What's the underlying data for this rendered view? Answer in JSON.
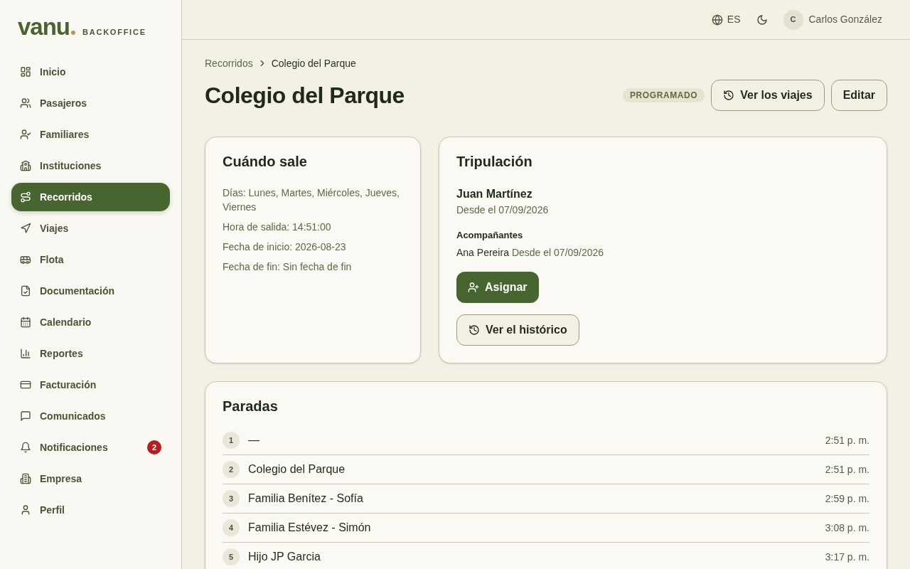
{
  "sidebar": {
    "logo": {
      "wordmark": "vanu",
      "subtitle": "BACKOFFICE"
    },
    "items": [
      {
        "label": "Inicio",
        "selected": false
      },
      {
        "label": "Pasajeros",
        "selected": false
      },
      {
        "label": "Familiares",
        "selected": false
      },
      {
        "label": "Instituciones",
        "selected": false
      },
      {
        "label": "Recorridos",
        "selected": true
      },
      {
        "label": "Viajes",
        "selected": false
      },
      {
        "label": "Flota",
        "selected": false
      },
      {
        "label": "Documentación",
        "selected": false
      },
      {
        "label": "Calendario",
        "selected": false
      },
      {
        "label": "Reportes",
        "selected": false
      },
      {
        "label": "Facturación",
        "selected": false
      },
      {
        "label": "Comunicados",
        "selected": false
      },
      {
        "label": "Notificaciones",
        "selected": false,
        "badge": "2"
      },
      {
        "label": "Empresa",
        "selected": false
      },
      {
        "label": "Perfil",
        "selected": false
      }
    ]
  },
  "topbar": {
    "language": "ES",
    "user": {
      "initial": "C",
      "name": "Carlos González"
    }
  },
  "breadcrumb": [
    "Recorridos",
    "Colegio del Parque"
  ],
  "header": {
    "title": "Colegio del Parque",
    "status": "PROGRAMADO",
    "buttons": [
      "Ver los viajes",
      "Editar"
    ]
  },
  "schedule": {
    "title": "Cuándo sale",
    "lines": [
      "Días: Lunes, Martes, Miércoles, Jueves, Viernes",
      "Hora de salida: 14:51:00",
      "Fecha de inicio: 2026-08-23",
      "Fecha de fin: Sin fecha de fin"
    ]
  },
  "crew": {
    "title": "Tripulación",
    "driver": {
      "name": "Juan Martínez",
      "since": "Desde el 07/09/2026"
    },
    "companions_label": "Acompañantes",
    "companions": [
      {
        "name": "Ana Pereira",
        "since": "Desde el 07/09/2026"
      }
    ],
    "assign_button": "Asignar",
    "history_button": "Ver el histórico"
  },
  "stops": {
    "title": "Paradas",
    "rows": [
      {
        "number": "1",
        "name": "—",
        "time": "2:51 p. m."
      },
      {
        "number": "2",
        "name": "Colegio del Parque",
        "time": "2:51 p. m."
      },
      {
        "number": "3",
        "name": "Familia Benítez - Sofía",
        "time": "2:59 p. m."
      },
      {
        "number": "4",
        "name": "Familia Estévez - Simón",
        "time": "3:08 p. m."
      },
      {
        "number": "5",
        "name": "Hijo JP Garcia",
        "time": "3:17 p. m."
      }
    ]
  }
}
